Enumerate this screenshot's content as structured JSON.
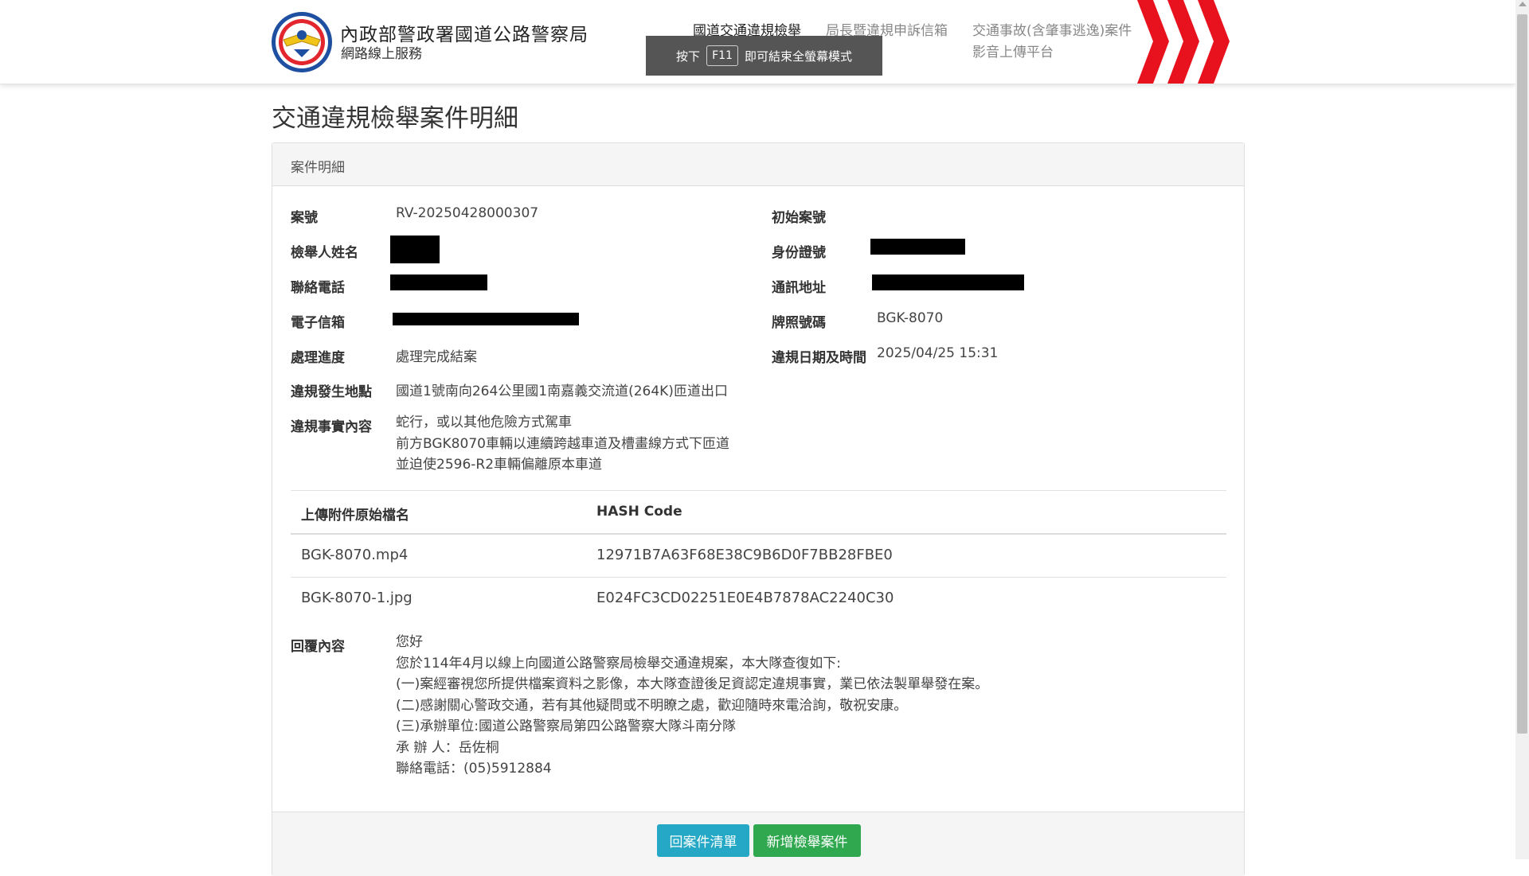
{
  "header": {
    "brand_title": "內政部警政署國道公路警察局",
    "brand_subtitle": "網路線上服務",
    "nav": [
      {
        "label": "國道交通違規檢舉"
      },
      {
        "label": "局長暨違規申訴信箱"
      },
      {
        "label_line1": "交通事故(含肇事逃逸)案件",
        "label_line2": "影音上傳平台"
      }
    ]
  },
  "toast": {
    "prefix": "按下",
    "key": "F11",
    "suffix": "即可結束全螢幕模式"
  },
  "page_title": "交通違規檢舉案件明細",
  "panel_heading": "案件明細",
  "fields": {
    "case_no_label": "案號",
    "case_no_value": "RV-20250428000307",
    "initial_case_label": "初始案號",
    "reporter_name_label": "檢舉人姓名",
    "id_label": "身份證號",
    "phone_label": "聯絡電話",
    "address_label": "通訊地址",
    "email_label": "電子信箱",
    "plate_label": "牌照號碼",
    "plate_value": "BGK-8070",
    "status_label": "處理進度",
    "status_value": "處理完成結案",
    "violation_datetime_label": "違規日期及時間",
    "violation_datetime_value": "2025/04/25 15:31",
    "location_label": "違規發生地點",
    "location_value": "國道1號南向264公里國1南嘉義交流道(264K)匝道出口",
    "facts_label": "違規事實內容",
    "facts_lines": [
      "蛇行，或以其他危險方式駕車",
      "前方BGK8070車輛以連續跨越車道及槽畫線方式下匝道",
      "並迫使2596-R2車輛偏離原本車道"
    ]
  },
  "attachments": {
    "headers": {
      "filename": "上傳附件原始檔名",
      "hash": "HASH Code"
    },
    "rows": [
      {
        "filename": "BGK-8070.mp4",
        "hash": "12971B7A63F68E38C9B6D0F7BB28FBE0"
      },
      {
        "filename": "BGK-8070-1.jpg",
        "hash": "E024FC3CD02251E0E4B7878AC2240C30"
      }
    ]
  },
  "reply": {
    "label": "回覆內容",
    "lines": [
      "您好",
      "您於114年4月以線上向國道公路警察局檢舉交通違規案，本大隊查復如下:",
      "(一)案經審視您所提供檔案資料之影像，本大隊查證後足資認定違規事實，業已依法製單舉發在案。",
      "(二)感謝關心警政交通，若有其他疑問或不明瞭之處，歡迎隨時來電洽詢，敬祝安康。",
      "(三)承辦單位:國道公路警察局第四公路警察大隊斗南分隊",
      "承 辦 人：岳佐桐",
      "聯絡電話：(05)5912884"
    ]
  },
  "buttons": {
    "back": "回案件清單",
    "new": "新增檢舉案件"
  },
  "colors": {
    "btn_back": "#24a8c6",
    "btn_new": "#2fa84f",
    "chevron": "#e8121e"
  }
}
